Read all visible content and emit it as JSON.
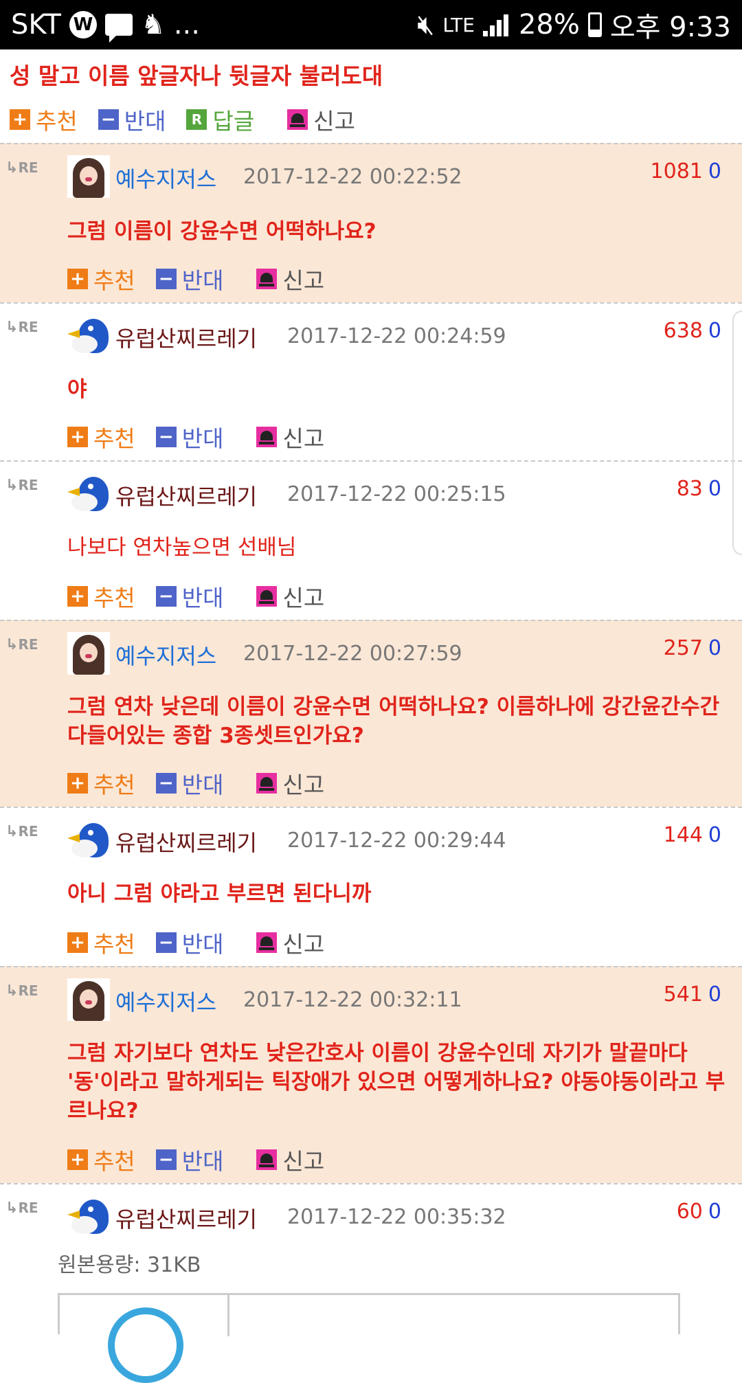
{
  "status_bar": {
    "carrier": "SKT",
    "w_badge": "W",
    "more": "...",
    "network": "LTE",
    "battery": "28%",
    "time": "오후 9:33"
  },
  "post": {
    "text": "성 말고 이름 앞글자나 뒷글자 불러도대",
    "like_label": "추천",
    "dislike_label": "반대",
    "reply_label": "답글",
    "report_label": "신고"
  },
  "comments": [
    {
      "author": "예수지저스",
      "date": "2017-12-22 00:22:52",
      "up": "1081",
      "down": "0",
      "text": "그럼 이름이 강윤수면 어떡하나요?"
    },
    {
      "author": "유럽산찌르레기",
      "date": "2017-12-22 00:24:59",
      "up": "638",
      "down": "0",
      "text": "야"
    },
    {
      "author": "유럽산찌르레기",
      "date": "2017-12-22 00:25:15",
      "up": "83",
      "down": "0",
      "text": "나보다 연차높으면 선배님"
    },
    {
      "author": "예수지저스",
      "date": "2017-12-22 00:27:59",
      "up": "257",
      "down": "0",
      "text": "그럼 연차 낮은데 이름이 강윤수면 어떡하나요? 이름하나에 강간윤간수간 다들어있는 종합 3종셋트인가요?"
    },
    {
      "author": "유럽산찌르레기",
      "date": "2017-12-22 00:29:44",
      "up": "144",
      "down": "0",
      "text": "아니 그럼 야라고 부르면 된다니까"
    },
    {
      "author": "예수지저스",
      "date": "2017-12-22 00:32:11",
      "up": "541",
      "down": "0",
      "text": "그럼 자기보다 연차도 낮은간호사 이름이 강윤수인데 자기가 말끝마다 '동'이라고 말하게되는 틱장애가 있으면 어떻게하나요? 야동야동이라고 부르나요?"
    },
    {
      "author": "유럽산찌르레기",
      "date": "2017-12-22 00:35:32",
      "up": "60",
      "down": "0",
      "original_size": "원본용량: 31KB"
    }
  ],
  "labels": {
    "re": "RE",
    "like": "추천",
    "dislike": "반대",
    "report": "신고"
  },
  "colors": {
    "highlight_bg": "#fbe7d6",
    "text_red": "#e0241b",
    "author_blue": "#1f6fd6",
    "author_dark": "#6b1717"
  }
}
